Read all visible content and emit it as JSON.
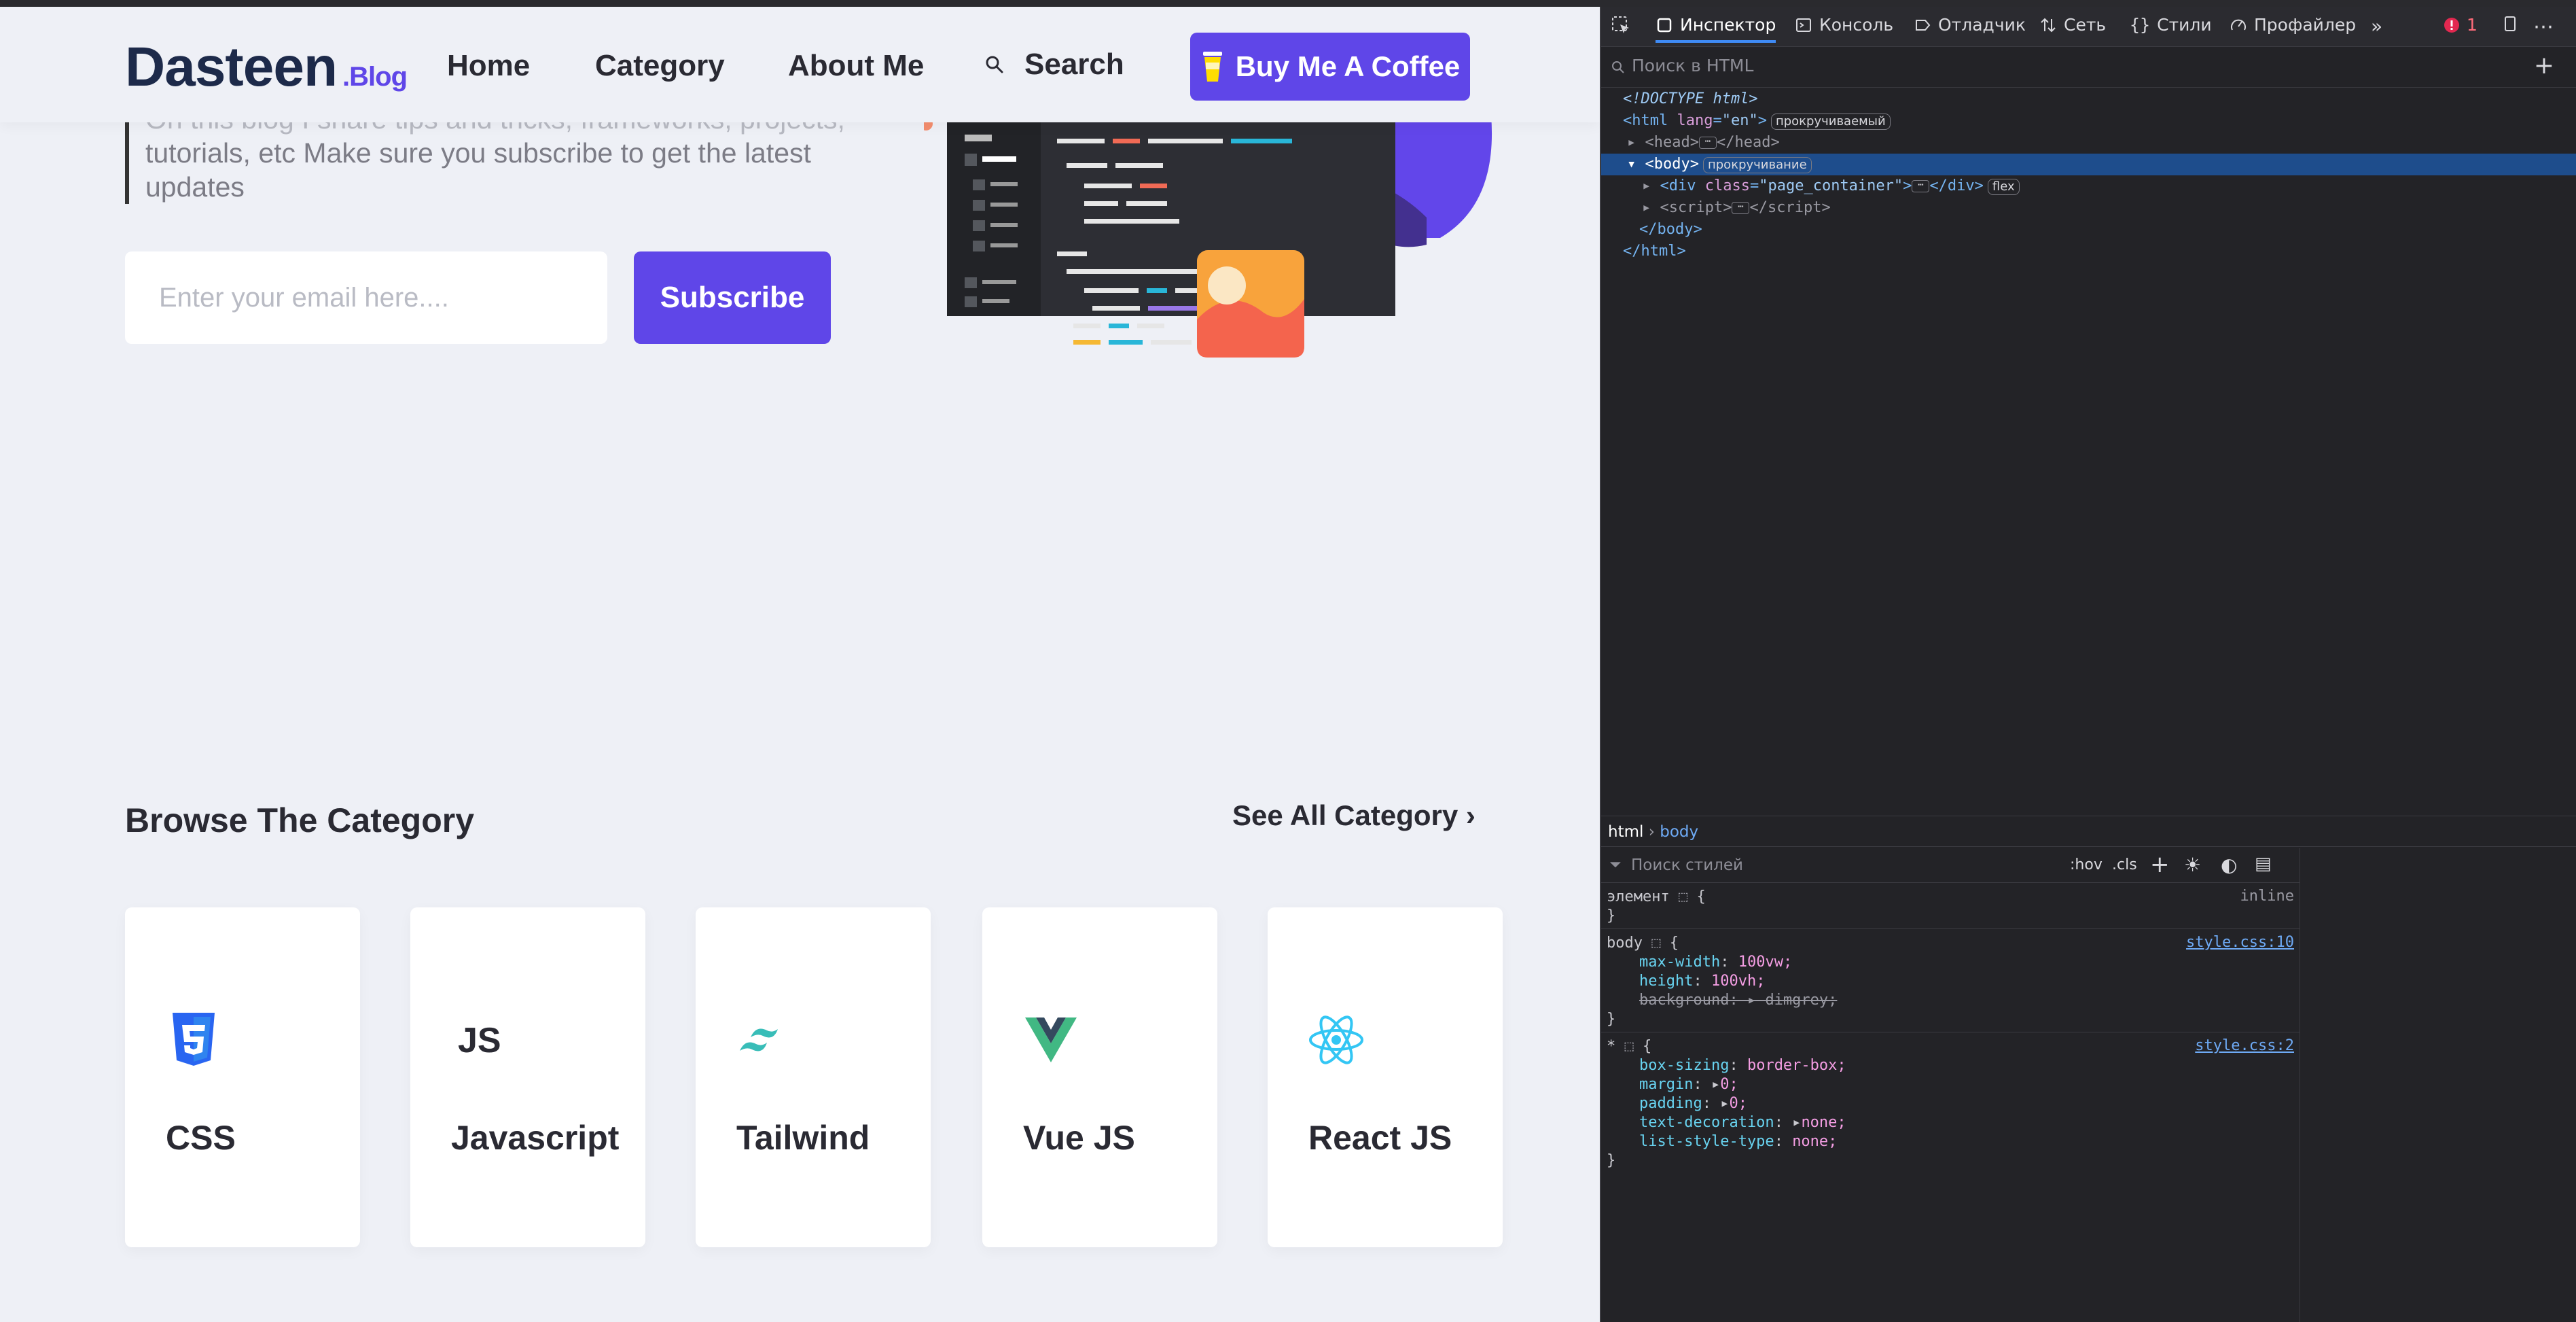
{
  "site": {
    "logo": {
      "name": "Dasteen",
      "suffix": ".Blog"
    },
    "nav": {
      "home": "Home",
      "category": "Category",
      "about": "About Me",
      "search": "Search"
    },
    "coffee_button": "Buy Me A Coffee",
    "hero": {
      "line1": "On this blog I share tips and tricks, frameworks, projects,",
      "line2": "tutorials, etc Make sure you subscribe to get the latest",
      "line3": "updates"
    },
    "subscribe": {
      "placeholder": "Enter your email here....",
      "button": "Subscribe"
    },
    "category_section": {
      "title": "Browse The Category",
      "see_all": "See All Category"
    },
    "categories": [
      {
        "name": "CSS",
        "icon": "css3-icon",
        "color": "#2965f1"
      },
      {
        "name": "Javascript",
        "icon": "js-icon",
        "color": "#2a2a33"
      },
      {
        "name": "Tailwind",
        "icon": "tailwind-icon",
        "color": "#38bdb8"
      },
      {
        "name": "Vue JS",
        "icon": "vue-icon",
        "color": "#41b883"
      },
      {
        "name": "React JS",
        "icon": "react-icon",
        "color": "#33c6f4"
      }
    ],
    "colors": {
      "accent": "#5f46e8",
      "background": "#eef0f6"
    }
  },
  "devtools": {
    "tabs": [
      "Инспектор",
      "Консоль",
      "Отладчик",
      "Сеть",
      "Стили",
      "Профайлер"
    ],
    "error_count": "1",
    "search_placeholder": "Поиск в HTML",
    "tree": {
      "doctype": "<!DOCTYPE html>",
      "html_open_tag": "html",
      "html_lang_attr": "lang",
      "html_lang_val": "\"en\"",
      "html_badge": "прокручиваемый",
      "head_tag": "head",
      "body_tag": "body",
      "body_badge": "прокручивание",
      "div_tag": "div",
      "div_class_attr": "class",
      "div_class_val": "\"page_container\"",
      "div_badge": "flex",
      "script_tag": "script",
      "body_close": "</body>",
      "html_close": "</html>"
    },
    "breadcrumb": {
      "html": "html",
      "body": "body"
    },
    "styles": {
      "filter_placeholder": "Поиск стилей",
      "hov": ":hov",
      "cls": ".cls",
      "element_rule": "элемент",
      "inline": "inline",
      "body_rule": {
        "selector": "body",
        "source": "style.css:10",
        "props": [
          {
            "name": "max-width",
            "value": "100vw;"
          },
          {
            "name": "height",
            "value": "100vh;"
          },
          {
            "name": "background",
            "value": "dimgrey;"
          }
        ]
      },
      "star_rule": {
        "selector": "*",
        "source": "style.css:2",
        "props": [
          {
            "name": "box-sizing",
            "value": "border-box;"
          },
          {
            "name": "margin",
            "value": "0;"
          },
          {
            "name": "padding",
            "value": "0;"
          },
          {
            "name": "text-decoration",
            "value": "none;"
          },
          {
            "name": "list-style-type",
            "value": "none;"
          }
        ]
      }
    }
  }
}
